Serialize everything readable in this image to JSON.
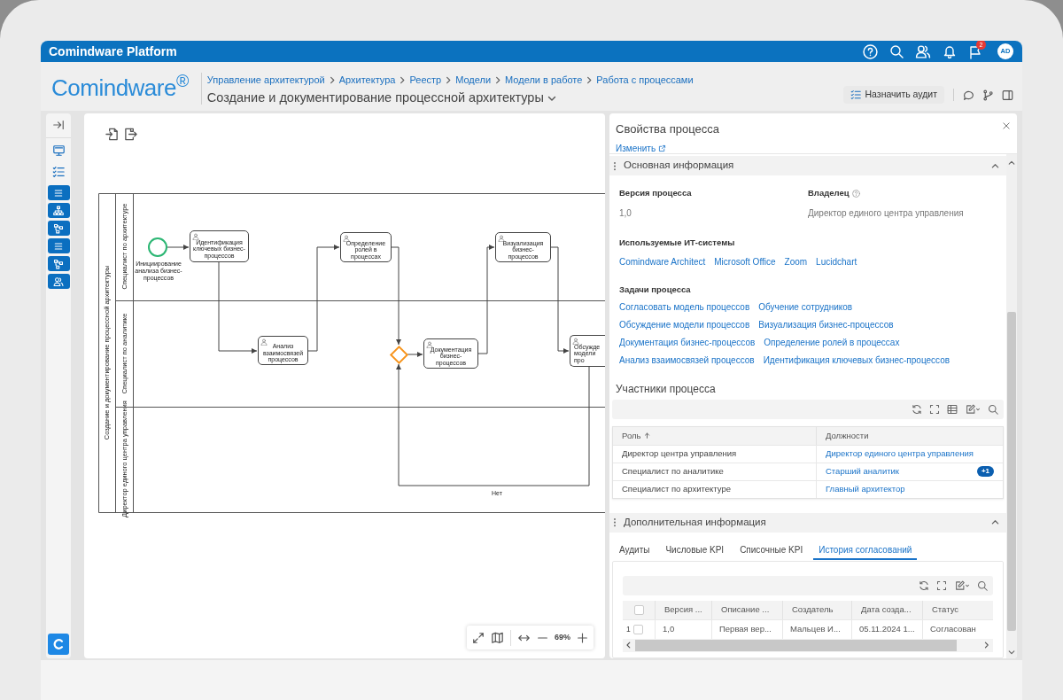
{
  "app": {
    "title": "Comindware Platform",
    "notification_count": "2",
    "avatar": "AD"
  },
  "header": {
    "logo": "Comindware$^{®}$",
    "breadcrumbs": [
      "Управление архитектурой",
      "Архитектура",
      "Реестр",
      "Модели",
      "Модели в работе",
      "Работа с процессами"
    ],
    "title": "Создание и документирование процессной архитектуры",
    "audit_button": "Назначить аудит"
  },
  "diagram": {
    "pool": "Создание и документирование процессной архитектуры",
    "lanes": [
      "Специалист по архитектуре",
      "Специалист по аналитике",
      "Директор единого центра управления"
    ],
    "nodes": [
      {
        "kind": "start",
        "label": "Инициирование анализа бизнес-процессов"
      },
      {
        "kind": "task",
        "label": "Идентификация ключевых бизнес-процессов"
      },
      {
        "kind": "task",
        "label": "Анализ взаимосвязей процессов"
      },
      {
        "kind": "task",
        "label": "Определение ролей в процессах"
      },
      {
        "kind": "gateway"
      },
      {
        "kind": "task",
        "label": "Документация бизнес-процессов"
      },
      {
        "kind": "task",
        "label": "Визуализация бизнес-процессов"
      },
      {
        "kind": "task",
        "label": "Обсужде модели про"
      }
    ],
    "edge_label": "Нет",
    "zoom": "69%"
  },
  "properties": {
    "title": "Свойства процесса",
    "edit_link": "Изменить",
    "main_info": {
      "header": "Основная информация",
      "expanded": true,
      "fields": [
        {
          "label": "Версия процесса",
          "value": "1,0",
          "help": false
        },
        {
          "label": "Владелец",
          "value": "Директор единого центра управления",
          "help": true
        }
      ],
      "it_systems": {
        "label": "Используемые ИТ-системы",
        "items": [
          "Comindware Architect",
          "Microsoft Office",
          "Zoom",
          "Lucidchart"
        ]
      },
      "tasks": {
        "label": "Задачи процесса",
        "items": [
          "Согласовать модель процессов",
          "Обучение сотрудников",
          "Обсуждение модели процессов",
          "Визуализация бизнес-процессов",
          "Документация бизнес-процессов",
          "Определение ролей в процессах",
          "Анализ взаимосвязей процессов",
          "Идентификация ключевых бизнес-процессов"
        ]
      }
    },
    "participants": {
      "title": "Участники процесса",
      "columns": [
        {
          "label": "Роль",
          "sorted": true
        },
        {
          "label": "Должности",
          "sorted": false
        }
      ],
      "rows": [
        {
          "role": "Директор центра управления",
          "position": "Директор единого центра управления"
        },
        {
          "role": "Специалист по аналитике",
          "position": "Старший аналитик",
          "more": "+1"
        },
        {
          "role": "Специалист по архитектуре",
          "position": "Главный архитектор"
        }
      ]
    },
    "additional": {
      "header": "Дополнительная информация",
      "expanded": true,
      "tabs": [
        {
          "label": "Аудиты",
          "selected": false
        },
        {
          "label": "Числовые KPI",
          "selected": false
        },
        {
          "label": "Списочные KPI",
          "selected": false
        },
        {
          "label": "История согласований",
          "selected": true
        }
      ],
      "table": {
        "all_checked": false,
        "columns": [
          "Версия ...",
          "Описание ...",
          "Создатель",
          "Дата созда...",
          "Статус"
        ],
        "rows": [
          {
            "number": "1",
            "checked": false,
            "cells": [
              "1,0",
              "Первая вер...",
              "Мальцев И...",
              "05.11.2024 1...",
              "Согласован"
            ]
          }
        ]
      }
    }
  }
}
